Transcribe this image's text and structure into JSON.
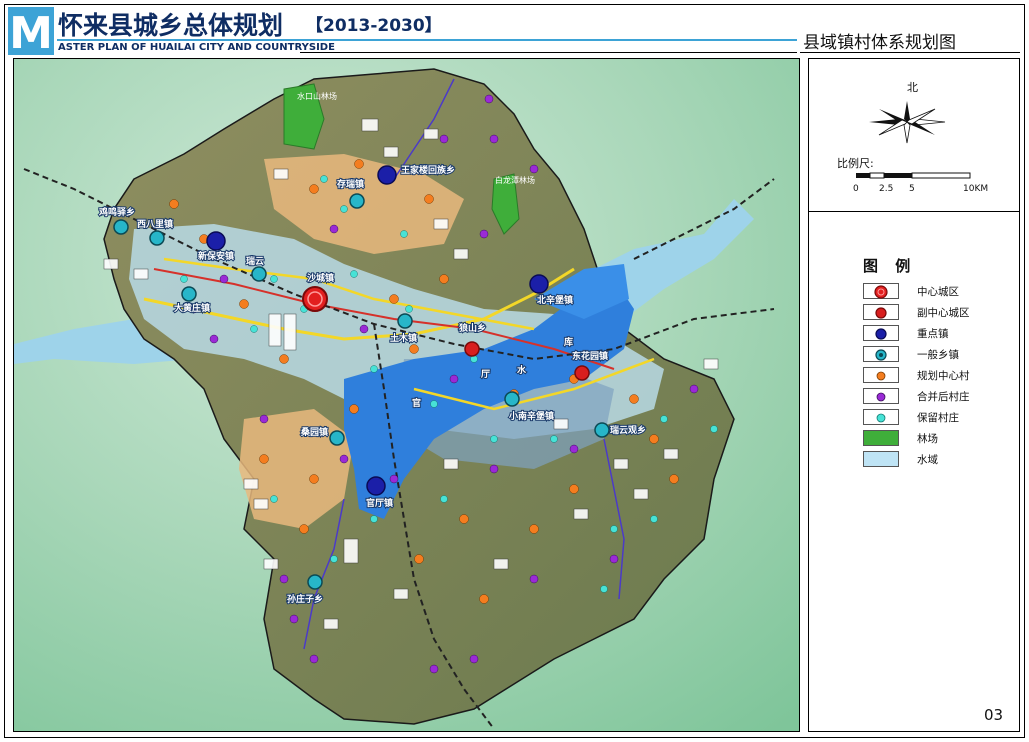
{
  "header": {
    "logo_letter": "M",
    "title_cn": "怀来县城乡总体规划",
    "title_years": "【2013-2030】",
    "title_en": "ASTER PLAN OF HUAILAI CITY AND COUNTRYSIDE",
    "map_subtitle": "县域镇村体系规划图"
  },
  "compass": {
    "north_label": "北"
  },
  "scale": {
    "label": "比例尺:",
    "ticks": [
      "0",
      "2.5",
      "5",
      "10KM"
    ]
  },
  "legend": {
    "title": "图  例",
    "items": [
      {
        "label": "中心城区",
        "swatch": "big-red-circle",
        "color": "#e21f1f"
      },
      {
        "label": "副中心城区",
        "swatch": "red-circle",
        "color": "#d81e1e"
      },
      {
        "label": "重点镇",
        "swatch": "navy-circle",
        "color": "#1b1fa8"
      },
      {
        "label": "一般乡镇",
        "swatch": "cyan-ring",
        "color": "#27b6c9"
      },
      {
        "label": "规划中心村",
        "swatch": "orange-dot",
        "color": "#f47d1f"
      },
      {
        "label": "合并后村庄",
        "swatch": "purple-dot",
        "color": "#9a2ad6"
      },
      {
        "label": "保留村庄",
        "swatch": "cyan-dot",
        "color": "#47e2d6"
      },
      {
        "label": "林场",
        "swatch": "green-fill",
        "color": "#3fae3a"
      },
      {
        "label": "水域",
        "swatch": "lightblue-fill",
        "color": "#bfe4f5"
      }
    ]
  },
  "map": {
    "places": [
      "沙城镇",
      "新保安镇",
      "土木镇",
      "北辛堡镇",
      "东花园镇",
      "狼山乡",
      "存瑞镇",
      "小南辛堡镇",
      "瑞云观乡",
      "桑园镇",
      "王家楼回族乡",
      "孙庄子乡",
      "西八里镇",
      "大黄庄镇",
      "鸡鸣驿乡",
      "瑞云",
      "官厅镇"
    ],
    "forest_labels": [
      "水口山林场",
      "白龙潭林场"
    ],
    "water_labels": [
      "官",
      "厅",
      "水",
      "库"
    ]
  },
  "page_number": "03"
}
